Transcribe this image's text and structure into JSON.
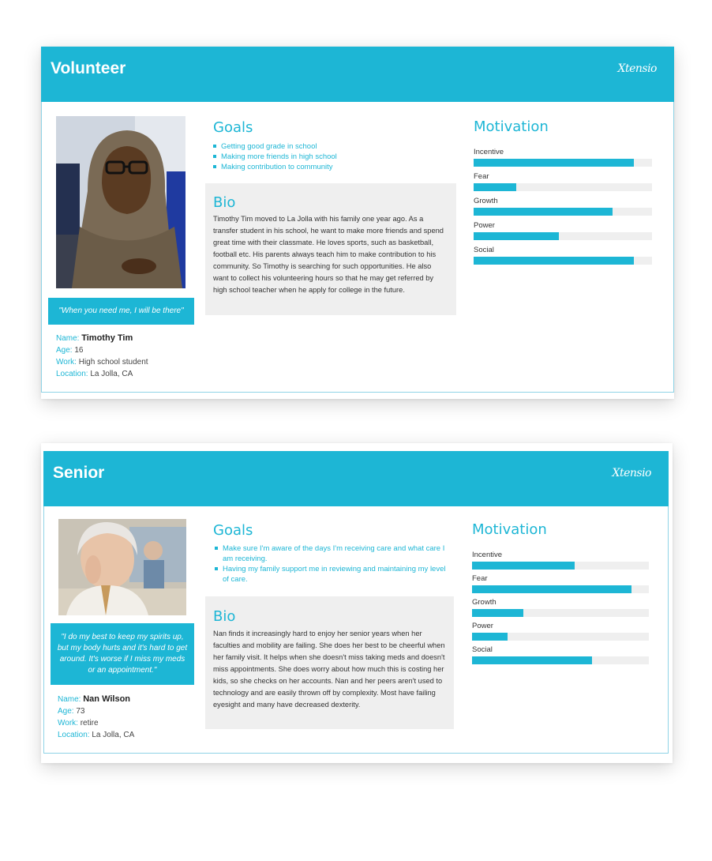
{
  "personas": [
    {
      "id": "volunteer",
      "title": "Volunteer",
      "logo": "Xtensio",
      "quote": "\"When you need me, I will be there\"",
      "info": {
        "name_label": "Name:",
        "name": "Timothy Tim",
        "age_label": "Age:",
        "age": "16",
        "work_label": "Work:",
        "work": "High school student",
        "location_label": "Location:",
        "location": "La Jolla, CA"
      },
      "goals_heading": "Goals",
      "goals": [
        "Getting good grade in school",
        "Making more friends in high school",
        "Making contribution to community"
      ],
      "bio_heading": "Bio",
      "bio": "Timothy Tim moved to La Jolla with his family one year ago. As a transfer student in his school, he want to make more friends and spend great time with their classmate. He loves sports, such as basketball, football etc. His parents always teach him to make contribution to his community. So Timothy is searching for such opportunities. He also want to collect his volunteering hours so that he may get referred by high school teacher when he apply for college in the future.",
      "motivation_heading": "Motivation",
      "motivation": [
        {
          "label": "Incentive",
          "value": 0.9
        },
        {
          "label": "Fear",
          "value": 0.24
        },
        {
          "label": "Growth",
          "value": 0.78
        },
        {
          "label": "Power",
          "value": 0.48
        },
        {
          "label": "Social",
          "value": 0.9
        }
      ]
    },
    {
      "id": "senior",
      "title": "Senior",
      "logo": "Xtensio",
      "quote": "\"I do my best to keep my spirits up, but my body hurts and it's hard to get around. It's worse if I miss my meds or an appointment.\"",
      "info": {
        "name_label": "Name:",
        "name": "Nan Wilson",
        "age_label": "Age:",
        "age": "73",
        "work_label": "Work:",
        "work": "retire",
        "location_label": "Location:",
        "location": "La Jolla, CA"
      },
      "goals_heading": "Goals",
      "goals": [
        "Make sure I'm aware of the days I'm receiving care and what care I am receiving.",
        "Having my family support me in reviewing and maintaining my level of care."
      ],
      "bio_heading": "Bio",
      "bio": "Nan finds it increasingly hard to enjoy her senior years when her faculties and mobility are failing. She does her best to be cheerful when her family visit. It helps when she doesn't miss taking meds and doesn't miss appointments. She does worry about how much this is costing her kids, so she checks on her accounts. Nan and her peers aren't used to technology and are easily thrown off by complexity. Most have failing eyesight and many have decreased dexterity.",
      "motivation_heading": "Motivation",
      "motivation": [
        {
          "label": "Incentive",
          "value": 0.58
        },
        {
          "label": "Fear",
          "value": 0.9
        },
        {
          "label": "Growth",
          "value": 0.29
        },
        {
          "label": "Power",
          "value": 0.2
        },
        {
          "label": "Social",
          "value": 0.68
        }
      ]
    }
  ],
  "colors": {
    "accent": "#1db6d5",
    "track": "#efefef",
    "bio_bg": "#efefef"
  }
}
